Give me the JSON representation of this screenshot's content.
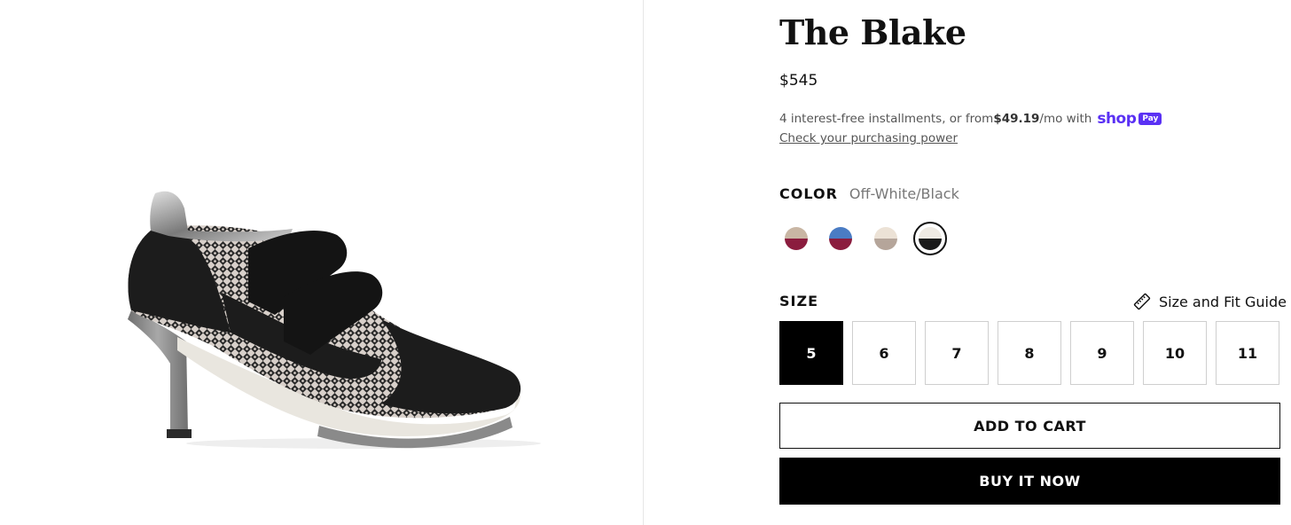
{
  "product": {
    "title": "The Blake",
    "price": "$545",
    "image_alt": "black-velcro-heeled-sneaker"
  },
  "installments": {
    "prefix": "4 interest-free installments, or from ",
    "amount": "$49.19",
    "suffix": "/mo with",
    "shop_word": "shop",
    "pay_badge": "Pay",
    "link": "Check your purchasing power"
  },
  "color": {
    "label": "COLOR",
    "selected": "Off-White/Black",
    "swatches": [
      {
        "name": "burgundy-beige",
        "top": "#c9b6a4",
        "bottom": "#8b1c3e",
        "selected": false
      },
      {
        "name": "blue-burgundy",
        "top": "#4a7cc4",
        "bottom": "#8b1c3e",
        "selected": false
      },
      {
        "name": "beige-taupe",
        "top": "#ece2d6",
        "bottom": "#b5a59a",
        "selected": false
      },
      {
        "name": "off-white-black",
        "top": "#eeeae3",
        "bottom": "#1a1a1a",
        "selected": true
      }
    ]
  },
  "size": {
    "label": "SIZE",
    "guide": "Size and Fit Guide",
    "options": [
      "5",
      "6",
      "7",
      "8",
      "9",
      "10",
      "11"
    ],
    "selected": "5"
  },
  "actions": {
    "add_to_cart": "ADD TO CART",
    "buy_now": "BUY IT NOW"
  },
  "colors": {
    "shop_brand": "#5a31f4",
    "primary": "#000000"
  }
}
